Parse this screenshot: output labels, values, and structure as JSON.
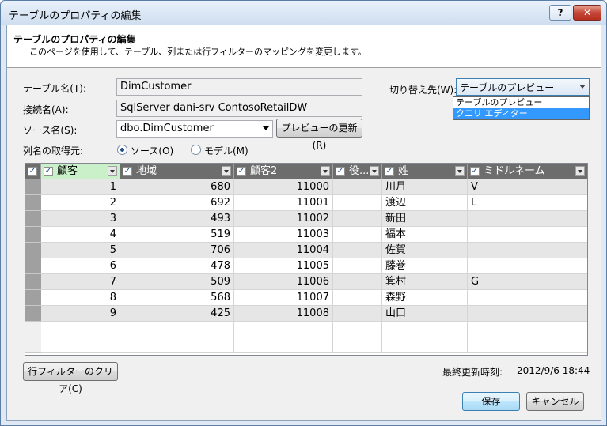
{
  "window": {
    "title": "テーブルのプロパティの編集",
    "help_label": "?",
    "close_label": "✕"
  },
  "header": {
    "title": "テーブルのプロパティの編集",
    "description": "このページを使用して、テーブル、列または行フィルターのマッピングを変更します。"
  },
  "form": {
    "table_name_label": "テーブル名(T):",
    "table_name_value": "DimCustomer",
    "connection_label": "接続名(A):",
    "connection_value": "SqlServer dani-srv ContosoRetailDW",
    "source_label": "ソース名(S):",
    "source_value": "dbo.DimCustomer",
    "refresh_preview_label": "プレビューの更新(R)",
    "column_source_label": "列名の取得元:",
    "radio_source_label": "ソース(O)",
    "radio_model_label": "モデル(M)",
    "switch_label": "切り替え先(W):",
    "switch_value": "テーブルのプレビュー",
    "switch_options": [
      "テーブルのプレビュー",
      "クエリ エディター"
    ]
  },
  "grid": {
    "columns": [
      "顧客",
      "地域",
      "顧客2",
      "役...",
      "姓",
      "ミドルネーム"
    ],
    "rows": [
      [
        "1",
        "680",
        "11000",
        "",
        "川月",
        "V"
      ],
      [
        "2",
        "692",
        "11001",
        "",
        "渡辺",
        "L"
      ],
      [
        "3",
        "493",
        "11002",
        "",
        "新田",
        ""
      ],
      [
        "4",
        "519",
        "11003",
        "",
        "福本",
        ""
      ],
      [
        "5",
        "706",
        "11004",
        "",
        "佐賀",
        ""
      ],
      [
        "6",
        "478",
        "11005",
        "",
        "藤巻",
        ""
      ],
      [
        "7",
        "509",
        "11006",
        "",
        "箕村",
        "G"
      ],
      [
        "8",
        "568",
        "11007",
        "",
        "森野",
        ""
      ],
      [
        "9",
        "425",
        "11008",
        "",
        "山口",
        ""
      ]
    ]
  },
  "footer": {
    "clear_filter_label": "行フィルターのクリア(C)",
    "last_updated_label": "最終更新時刻:",
    "last_updated_value": "2012/9/6 18:44",
    "save_label": "保存",
    "cancel_label": "キャンセル"
  }
}
